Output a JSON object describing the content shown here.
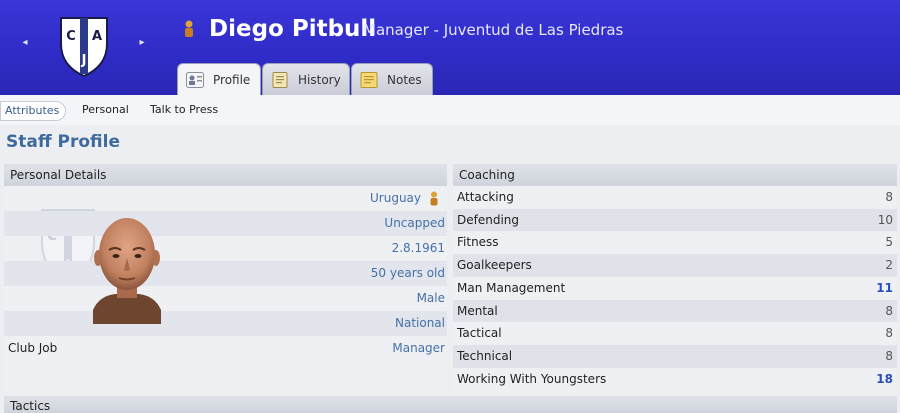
{
  "header": {
    "name": "Diego Pitbull",
    "role": "Manager - Juventud de Las Piedras",
    "crest_letters": [
      "C",
      "A",
      "J"
    ],
    "colors": {
      "bar": "#2f2bc6",
      "accent": "#4670a8",
      "highlight": "#2a4fb8"
    }
  },
  "tabs": [
    {
      "label": "Profile",
      "icon": "profile-icon"
    },
    {
      "label": "History",
      "icon": "history-icon"
    },
    {
      "label": "Notes",
      "icon": "notes-icon"
    }
  ],
  "subnav": [
    "Attributes",
    "Personal",
    "Talk to Press"
  ],
  "page_title": "Staff Profile",
  "personal": {
    "header": "Personal Details",
    "nationality": "Uruguay",
    "caps": "Uncapped",
    "dob": "2.8.1961",
    "age": "50 years old",
    "gender": "Male",
    "level": "National",
    "club_job_label": "Club Job",
    "club_job": "Manager"
  },
  "coaching": {
    "header": "Coaching",
    "rows": [
      {
        "label": "Attacking",
        "value": "8"
      },
      {
        "label": "Defending",
        "value": "10"
      },
      {
        "label": "Fitness",
        "value": "5"
      },
      {
        "label": "Goalkeepers",
        "value": "2"
      },
      {
        "label": "Man Management",
        "value": "11"
      },
      {
        "label": "Mental",
        "value": "8"
      },
      {
        "label": "Tactical",
        "value": "8"
      },
      {
        "label": "Technical",
        "value": "8"
      },
      {
        "label": "Working With Youngsters",
        "value": "18"
      }
    ]
  },
  "tactics_header": "Tactics"
}
